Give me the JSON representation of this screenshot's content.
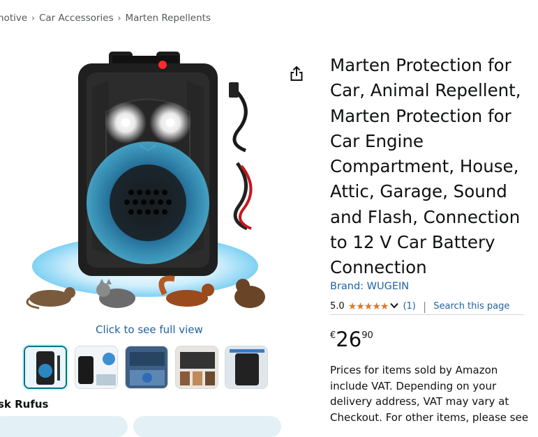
{
  "breadcrumb": {
    "items": [
      "notive",
      "Car Accessories",
      "Marten Repellents"
    ],
    "separator": "›"
  },
  "gallery": {
    "full_view_label": "Click to see full view",
    "thumbnail_count": 5,
    "selected_index": 0
  },
  "rufus": {
    "label": "sk Rufus"
  },
  "product": {
    "title": "Marten Protection for Car, Animal Repellent, Marten Protection for Car Engine Compartment, House, Attic, Garage, Sound and Flash, Connection to 12 V Car Battery Connection",
    "brand": "Brand: WUGEIN",
    "rating": "5.0",
    "stars": "★★★★★",
    "review_count": "(1)",
    "search_link": "Search this page",
    "separator": "|",
    "price": {
      "currency": "€",
      "whole": "26",
      "fraction": "90"
    },
    "vat_note": "Prices for items sold by Amazon include VAT. Depending on your delivery address, VAT may vary at Checkout. For other items, please see"
  },
  "colors": {
    "link": "#2162a1",
    "star": "#de7921",
    "text": "#0f1111",
    "muted": "#565959"
  },
  "icons": {
    "share": "share-icon",
    "chevron": "chevron-down-icon"
  }
}
